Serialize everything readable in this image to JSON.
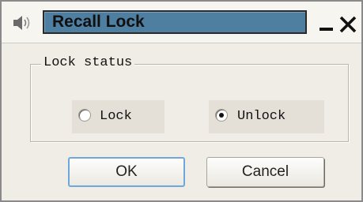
{
  "window": {
    "title": "Recall Lock",
    "minimize_label": "Minimize",
    "close_label": "Close"
  },
  "lock_status": {
    "legend": "Lock status",
    "options": [
      {
        "label": "Lock",
        "selected": false
      },
      {
        "label": "Unlock",
        "selected": true
      }
    ]
  },
  "buttons": {
    "ok_label": "OK",
    "cancel_label": "Cancel"
  },
  "icons": {
    "title_icon": "speaker-icon",
    "minimize": "minimize-icon",
    "close": "close-icon"
  },
  "colors": {
    "title_field": "#4e7fa0",
    "dialog_bg": "#f0ede6",
    "ok_focus_border": "#6fa8d8"
  }
}
